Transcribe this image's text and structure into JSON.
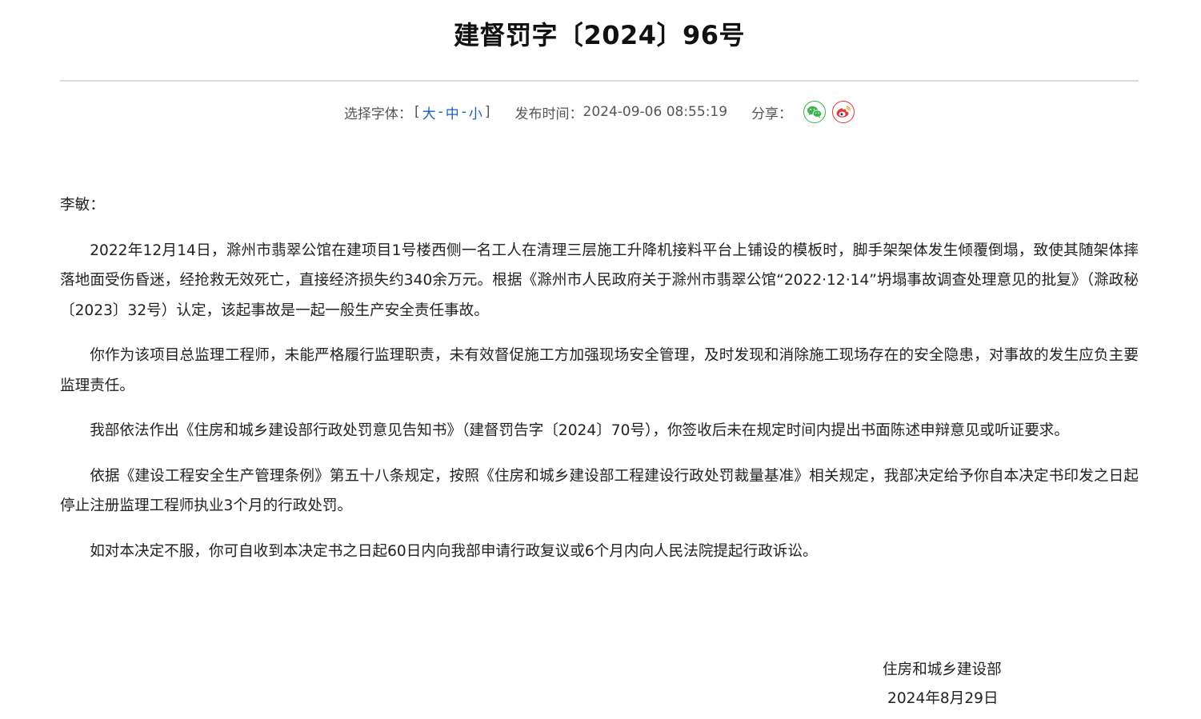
{
  "document": {
    "title": "建督罚字〔2024〕96号"
  },
  "meta": {
    "font_select_label": "选择字体：",
    "bracket_open": "[",
    "bracket_close": "]",
    "font_sizes": [
      "大",
      "中",
      "小"
    ],
    "separator": "-",
    "publish_label": "发布时间：",
    "publish_time": "2024-09-06 08:55:19",
    "share_label": "分享：",
    "share_icons": [
      "wechat-icon",
      "weibo-icon"
    ],
    "colors": {
      "link": "#1a62b8",
      "wechat": "#3bb24b",
      "weibo": "#e0383e"
    }
  },
  "body": {
    "salutation": "李敏：",
    "paragraphs": [
      "2022年12月14日，滁州市翡翠公馆在建项目1号楼西侧一名工人在清理三层施工升降机接料平台上铺设的模板时，脚手架架体发生倾覆倒塌，致使其随架体摔落地面受伤昏迷，经抢救无效死亡，直接经济损失约340余万元。根据《滁州市人民政府关于滁州市翡翠公馆“2022·12·14”坍塌事故调查处理意见的批复》（滁政秘〔2023〕32号）认定，该起事故是一起一般生产安全责任事故。",
      "你作为该项目总监理工程师，未能严格履行监理职责，未有效督促施工方加强现场安全管理，及时发现和消除施工现场存在的安全隐患，对事故的发生应负主要监理责任。",
      "我部依法作出《住房和城乡建设部行政处罚意见告知书》（建督罚告字〔2024〕70号），你签收后未在规定时间内提出书面陈述申辩意见或听证要求。",
      "依据《建设工程安全生产管理条例》第五十八条规定，按照《住房和城乡建设部工程建设行政处罚裁量基准》相关规定，我部决定给予你自本决定书印发之日起停止注册监理工程师执业3个月的行政处罚。",
      "如对本决定不服，你可自收到本决定书之日起60日内向我部申请行政复议或6个月内向人民法院提起行政诉讼。"
    ]
  },
  "signature": {
    "org": "住房和城乡建设部",
    "date": "2024年8月29日"
  }
}
